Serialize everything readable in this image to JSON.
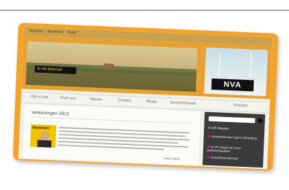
{
  "browser": {
    "menu": [
      "Bestand",
      "Bewerken",
      "Beeld"
    ]
  },
  "site": {
    "badge_text": "N-VA Beersel",
    "banner_word": "NVA"
  },
  "nav": {
    "tabs": [
      "Wie is wie",
      "Over ons",
      "Nieuws",
      "Contact",
      "Media",
      "Gemeenteraad",
      "Steunen"
    ]
  },
  "post": {
    "title": "Verkiezingen 2012",
    "thumb_label": "Stemmen!",
    "more_link": "Lees meer"
  },
  "sidebar": {
    "heading": "N-VA Nieuws",
    "items": [
      "Gemeenteraad: geen uitbreiding",
      "N-VA vraagt om meer parkeerplaatsen",
      "Zomerfeest Beersel"
    ]
  },
  "colors": {
    "frame": "#f3a32a",
    "header": "#e7a132",
    "sidebar": "#3b3b3b",
    "nva_yellow": "#f2c300"
  }
}
